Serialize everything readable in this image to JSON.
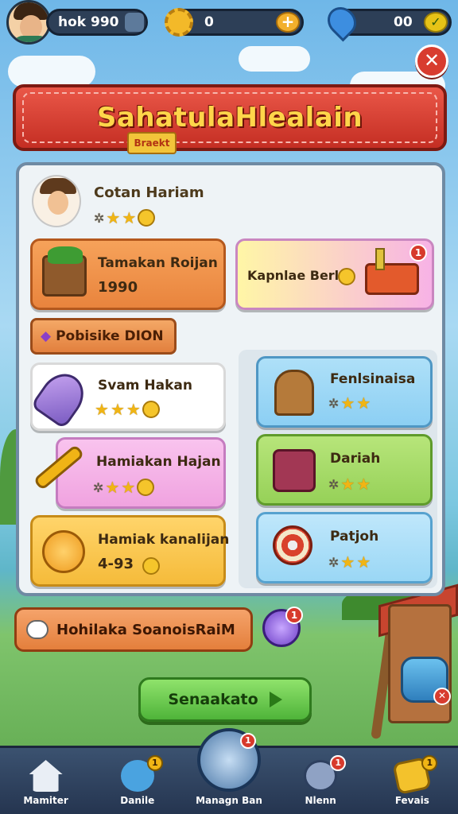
{
  "player": {
    "name": "hok 990"
  },
  "currency": {
    "coins": "0",
    "gems": "00"
  },
  "title": {
    "main": "SahatulaHlealain",
    "ribbon": "Braekt"
  },
  "profile": {
    "name": "Cotan Hariam"
  },
  "cards": {
    "top_left": {
      "title": "Tamakan Roijan",
      "value": "1990"
    },
    "top_right": {
      "title": "Kapnlae Berl",
      "badge": "1"
    },
    "section_tag": "Pobisike DION",
    "left": [
      {
        "title": "Svam Hakan"
      },
      {
        "title": "Hamiakan Hajan"
      },
      {
        "title": "Hamiak kanalijan",
        "value": "4-93"
      }
    ],
    "right": [
      {
        "title": "Fenlsinaisa"
      },
      {
        "title": "Dariah"
      },
      {
        "title": "Patjoh"
      }
    ]
  },
  "info_bar": {
    "text": "Hohilaka SoanoisRaiM",
    "orb_badge": "1"
  },
  "main_button": {
    "label": "Senaakato"
  },
  "nav": [
    {
      "label": "Mamiter",
      "icon": "house-icon"
    },
    {
      "label": "Danile",
      "icon": "tools-icon",
      "badge": "1"
    },
    {
      "label": "Managn Ban",
      "icon": "calculator-icon",
      "badge": "1"
    },
    {
      "label": "Nlenn",
      "icon": "compass-icon",
      "badge": "1"
    },
    {
      "label": "Fevais",
      "icon": "gift-icon",
      "badge": "1"
    }
  ],
  "colors": {
    "banner": "#d83c2f",
    "panel_border": "#6f8aa3",
    "nav_bg": "#2d3f57",
    "primary_button": "#4fb43a"
  }
}
